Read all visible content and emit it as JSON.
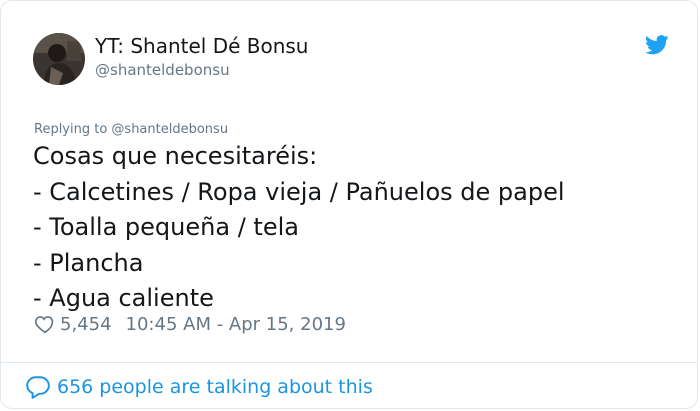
{
  "tweet": {
    "author": {
      "display_name": "YT: Shantel Dé Bonsu",
      "handle": "@shanteldebonsu",
      "avatar_icon": "user-avatar"
    },
    "brand_icon": "twitter-bird-icon",
    "reply_to": "Replying to @shanteldebonsu",
    "body_lines": [
      "Cosas que necesitaréis:",
      "- Calcetines / Ropa vieja / Pañuelos de papel",
      "- Toalla pequeña / tela",
      "- Plancha",
      "- Agua caliente"
    ],
    "likes": "5,454",
    "timestamp": "10:45 AM - Apr 15, 2019",
    "conversation_text": "656 people are talking about this"
  },
  "colors": {
    "accent": "#1da1f2",
    "link": "#1b95e0",
    "secondary_text": "#657786",
    "primary_text": "#14171a",
    "border": "#e1e8ed"
  }
}
